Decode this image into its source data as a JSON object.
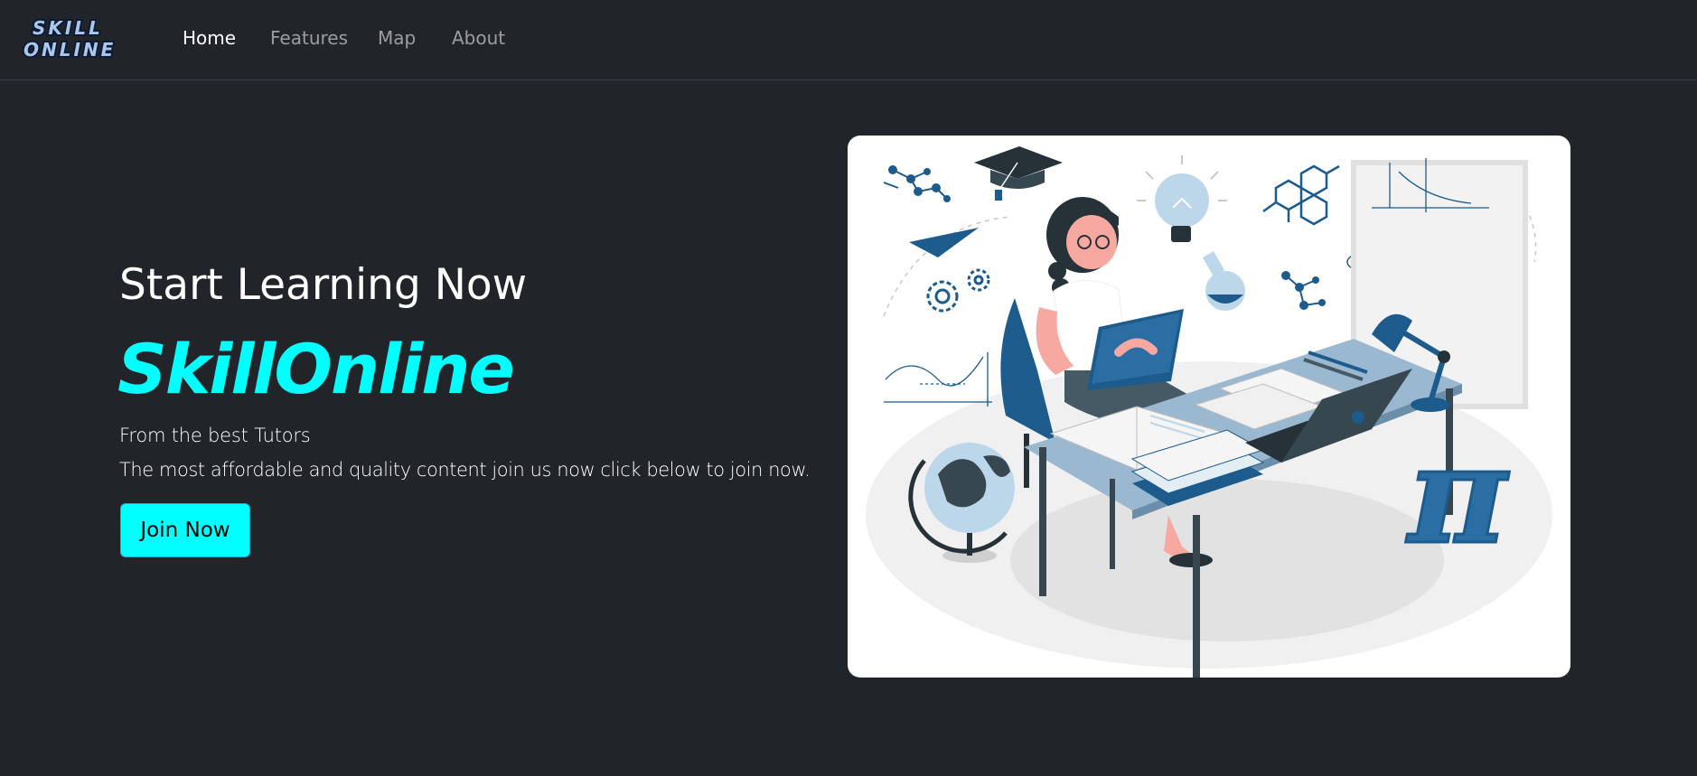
{
  "navbar": {
    "logo_line1": "SKILL",
    "logo_line2": "ONLINE",
    "links": [
      {
        "label": "Home",
        "active": true
      },
      {
        "label": "Features",
        "active": false
      },
      {
        "label": "Map",
        "active": false
      },
      {
        "label": "About",
        "active": false
      }
    ]
  },
  "hero": {
    "title": "Start Learning Now",
    "brand": "SkillOnline",
    "line1": "From the best Tutors",
    "line2": "The most affordable and quality content join us now click below to join now.",
    "button_label": "Join Now"
  },
  "illustration": {
    "pi_symbol": "π"
  },
  "colors": {
    "background": "#212529",
    "accent": "#00ffff",
    "illustration_blue": "#1c5b8b"
  }
}
